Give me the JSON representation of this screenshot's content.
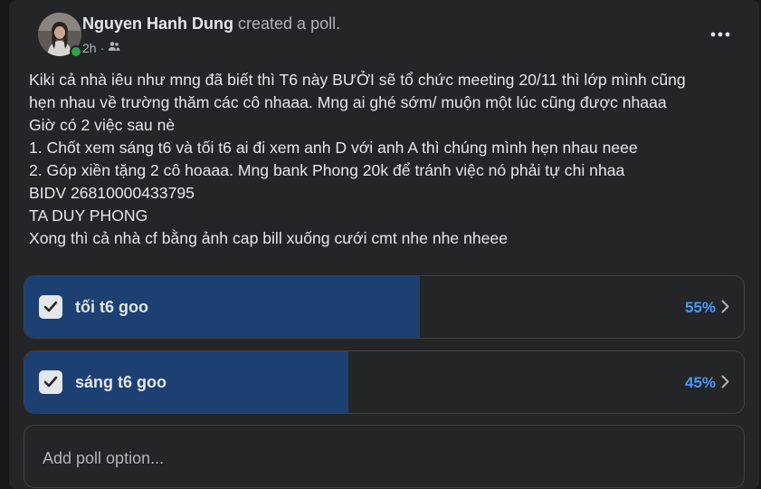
{
  "post": {
    "author": "Nguyen Hanh Dung",
    "action": "created a poll.",
    "time": "2h",
    "separator": "·",
    "audience_icon": "friends-icon",
    "more_icon": "more-horizontal-icon",
    "lines": [
      "Kiki cả nhà iêu như mng đã biết thì T6 này BƯỞI sẽ tổ chức meeting 20/11 thì lớp mình cũng",
      "hẹn nhau về trường thăm các cô nhaaa. Mng ai ghé sớm/ muộn một lúc cũng được nhaaa",
      "Giờ có 2 việc sau nè",
      "1. Chốt xem sáng t6 và tối t6 ai đi xem anh D với anh A thì chúng mình hẹn nhau neee",
      "2. Góp xiền tặng 2 cô hoaaa. Mng bank Phong 20k để tránh việc nó phải tự chi nhaa",
      "BIDV 26810000433795",
      "TA DUY PHONG",
      "Xong thì cả nhà cf bằng ảnh cap bill xuống cưới cmt nhe nhe nheee"
    ]
  },
  "poll": {
    "options": [
      {
        "label": "tối t6 goo",
        "percent_text": "55%",
        "share": 0.55,
        "checked": true
      },
      {
        "label": "sáng t6 goo",
        "percent_text": "45%",
        "share": 0.45,
        "checked": true
      }
    ],
    "add_option_placeholder": "Add poll option..."
  },
  "colors": {
    "background": "#18191a",
    "card": "#242526",
    "fill": "#1c4072",
    "percent": "#4599ff",
    "text": "#e4e6eb",
    "secondary_text": "#b0b3b8",
    "online": "#31a24c"
  }
}
